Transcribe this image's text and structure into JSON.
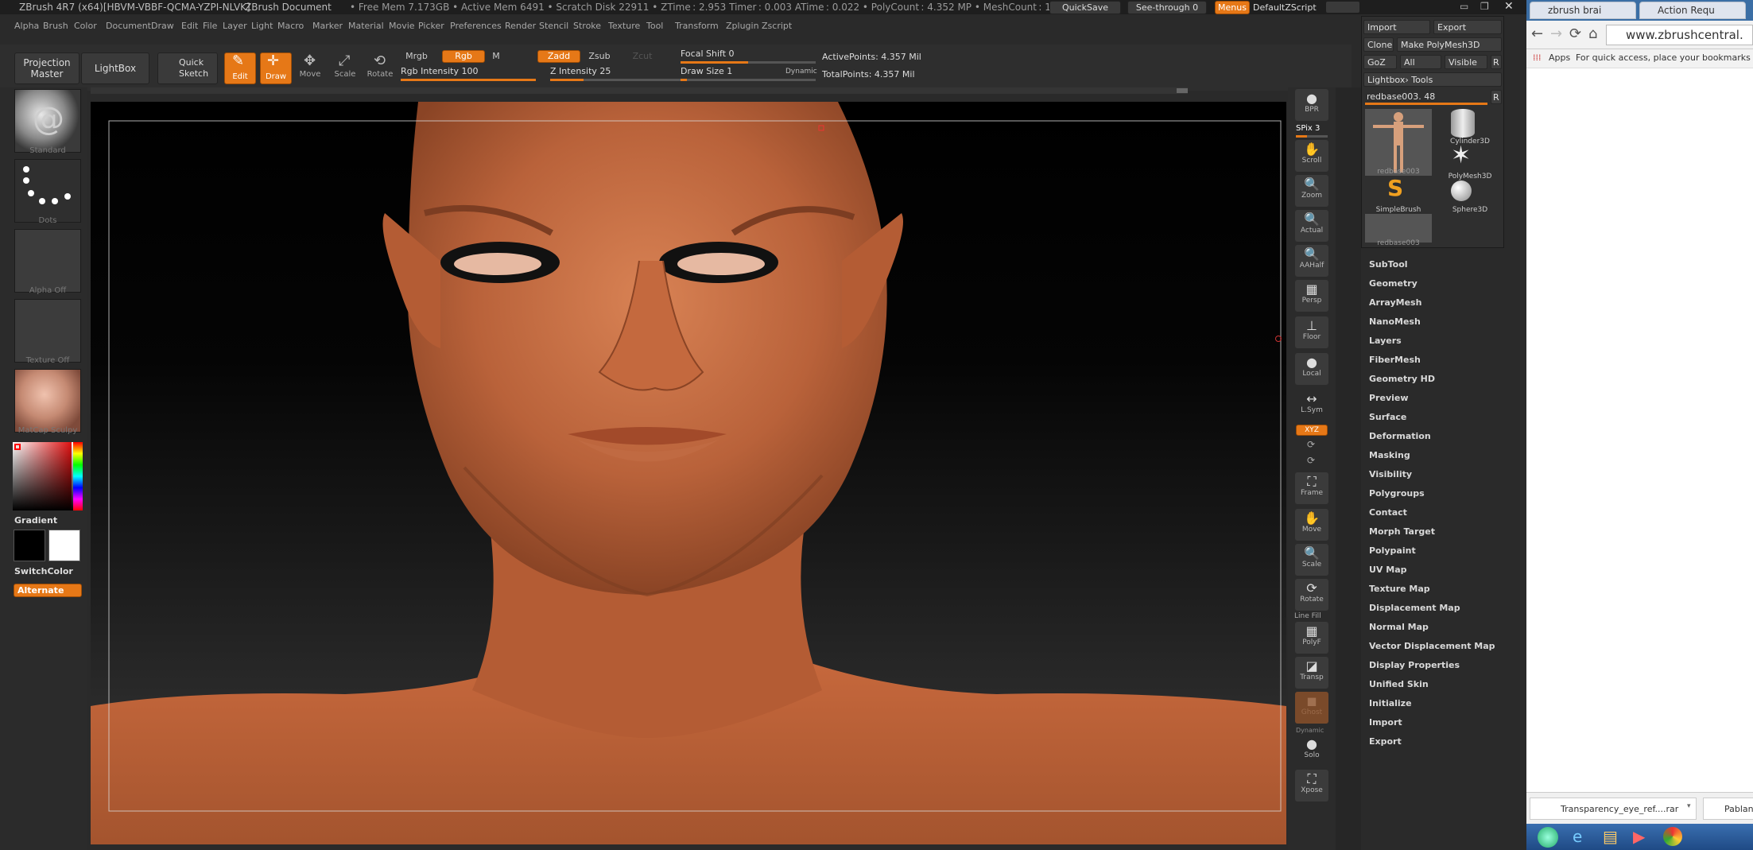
{
  "app": {
    "title_left": "ZBrush 4R7 (x64)[HBVM-VBBF-QCMA-YZPI-NLVK]",
    "document": "ZBrush Document",
    "stats": "• Free Mem 7.173GB • Active Mem 6491 • Scratch Disk 22911 • ZTime : 2.953 Timer : 0.003 ATime : 0.022 • PolyCount : 4.352 MP • MeshCount : 1",
    "quicksave": "QuickSave",
    "seethrough": "See-through  0",
    "menus": "Menus",
    "default_script": "DefaultZScript"
  },
  "menubar": [
    "Alpha",
    "Brush",
    "Color",
    "Document",
    "Draw",
    "Edit",
    "File",
    "Layer",
    "Light",
    "Macro",
    "Marker",
    "Material",
    "Movie",
    "Picker",
    "Preferences",
    "Render",
    "Stencil",
    "Stroke",
    "Texture",
    "Tool",
    "Transform",
    "Zplugin",
    "Zscript"
  ],
  "toolbar": {
    "projection_master": "Projection Master",
    "lightbox": "LightBox",
    "quick_sketch": "Quick Sketch",
    "edit": "Edit",
    "draw": "Draw",
    "move": "Move",
    "scale": "Scale",
    "rotate": "Rotate",
    "mrgb": "Mrgb",
    "rgb": "Rgb",
    "m": "M",
    "zadd": "Zadd",
    "zsub": "Zsub",
    "zcut": "Zcut",
    "rgb_intensity": "Rgb  Intensity 100",
    "rgb_intensity_value": 1.0,
    "z_intensity": "Z  Intensity 25",
    "z_intensity_value": 0.25,
    "focal_shift": "Focal Shift 0",
    "draw_size": "Draw Size 1",
    "dynamic": "Dynamic",
    "active_points": "ActivePoints: 4.357 Mil",
    "total_points": "TotalPoints: 4.357 Mil"
  },
  "leftshelf": {
    "brush": "Standard",
    "stroke": "Dots",
    "alpha": "Alpha  Off",
    "texture": "Texture  Off",
    "material": "MatCap  Sculpy",
    "gradient": "Gradient",
    "switchcolor": "SwitchColor",
    "alternate": "Alternate"
  },
  "rightshelf": [
    {
      "label": "BPR",
      "glyph": "●"
    },
    {
      "label": "Scroll",
      "glyph": "✋"
    },
    {
      "label": "Zoom",
      "glyph": "🔍"
    },
    {
      "label": "Actual",
      "glyph": "🔍"
    },
    {
      "label": "AAHalf",
      "glyph": "🔍"
    },
    {
      "label": "Persp",
      "glyph": "▦"
    },
    {
      "label": "Floor",
      "glyph": "⊥"
    },
    {
      "label": "Local",
      "glyph": "●"
    },
    {
      "label": "L.Sym",
      "glyph": "↔"
    },
    {
      "label": "Frame",
      "glyph": "⛶"
    },
    {
      "label": "Move",
      "glyph": "✋"
    },
    {
      "label": "Scale",
      "glyph": "🔍"
    },
    {
      "label": "Rotate",
      "glyph": "⟳"
    },
    {
      "label": "PolyF",
      "glyph": "▦"
    },
    {
      "label": "Transp",
      "glyph": "◪"
    },
    {
      "label": "Ghost",
      "glyph": "◼"
    },
    {
      "label": "Solo",
      "glyph": "●"
    },
    {
      "label": "Xpose",
      "glyph": "⛶"
    }
  ],
  "spix": "SPix 3",
  "xyz": "XYZ",
  "line_fill": "Line Fill",
  "dynamic_small": "Dynamic",
  "toolpanel": {
    "import": "Import",
    "export": "Export",
    "clone": "Clone",
    "make_polymesh": "Make PolyMesh3D",
    "goz": "GoZ",
    "all": "All",
    "visible": "Visible",
    "r": "R",
    "lightbox_tools": "Lightbox› Tools",
    "current_tool": "redbase003. 48",
    "thumbs": [
      "redbase003",
      "Cylinder3D",
      "PolyMesh3D",
      "SimpleBrush",
      "Sphere3D",
      "redbase003"
    ]
  },
  "subpalettes": [
    "SubTool",
    "Geometry",
    "ArrayMesh",
    "NanoMesh",
    "Layers",
    "FiberMesh",
    "Geometry HD",
    "Preview",
    "Surface",
    "Deformation",
    "Masking",
    "Visibility",
    "Polygroups",
    "Contact",
    "Morph Target",
    "Polypaint",
    "UV Map",
    "Texture Map",
    "Displacement Map",
    "Normal Map",
    "Vector Displacement Map",
    "Display Properties",
    "Unified Skin",
    "Initialize",
    "Import",
    "Export"
  ],
  "chrome": {
    "tab1": "zbrush brai",
    "tab2": "Action Requ",
    "url": "www.zbrushcentral.",
    "apps": "Apps",
    "bookmarks_hint": "For quick access, place your bookmarks h",
    "download1": "Transparency_eye_ref....rar",
    "download2": "Pablan"
  }
}
